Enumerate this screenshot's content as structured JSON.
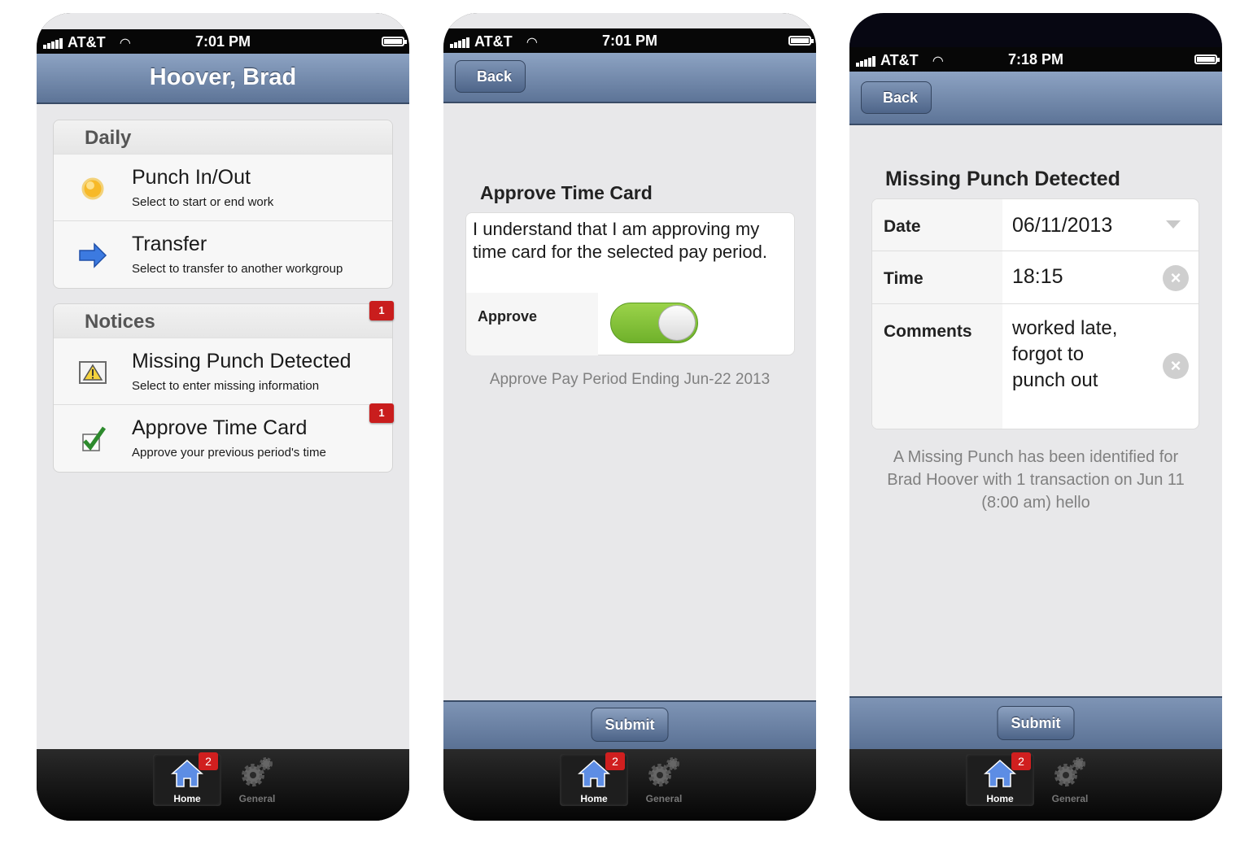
{
  "screens": [
    {
      "status": {
        "carrier": "AT&T",
        "time": "7:01 PM"
      },
      "nav_title": "Hoover, Brad",
      "daily": {
        "header": "Daily",
        "items": [
          {
            "title": "Punch In/Out",
            "subtitle": "Select to start or end work",
            "icon": "sun-icon"
          },
          {
            "title": "Transfer",
            "subtitle": "Select to transfer to another workgroup",
            "icon": "arrow-right-icon"
          }
        ]
      },
      "notices": {
        "header": "Notices",
        "badge": "1",
        "items": [
          {
            "title": "Missing Punch Detected",
            "subtitle": "Select to enter missing information",
            "icon": "warning-icon"
          },
          {
            "title": "Approve Time Card",
            "subtitle": "Approve your previous period's time",
            "icon": "checkmark-icon",
            "badge": "1"
          }
        ]
      }
    },
    {
      "status": {
        "carrier": "AT&T",
        "time": "7:01 PM"
      },
      "back_label": "Back",
      "section_title": "Approve Time Card",
      "statement": "I understand that I am approving my time card for the selected pay period.",
      "approve_label": "Approve",
      "approve_on": true,
      "note": "Approve Pay Period Ending Jun-22 2013",
      "submit_label": "Submit"
    },
    {
      "status": {
        "carrier": "AT&T",
        "time": "7:18 PM"
      },
      "back_label": "Back",
      "section_title": "Missing Punch Detected",
      "fields": {
        "date_label": "Date",
        "date_value": "06/11/2013",
        "time_label": "Time",
        "time_value": "18:15",
        "comments_label": "Comments",
        "comments_value": "worked late, forgot to punch out"
      },
      "note": "A Missing Punch has been identified for Brad Hoover with 1 transaction on Jun 11 (8:00 am) hello",
      "submit_label": "Submit"
    }
  ],
  "tabbar": {
    "home_label": "Home",
    "home_badge": "2",
    "general_label": "General"
  },
  "colors": {
    "nav_blue": "#6f86a9",
    "badge_red": "#c91d1d",
    "toggle_green": "#7fbf35"
  }
}
